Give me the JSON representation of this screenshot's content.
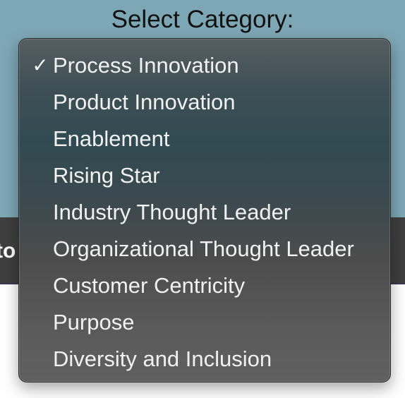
{
  "page": {
    "title": "Select Category:",
    "bar_text": "to"
  },
  "menu": {
    "selected_index": 0,
    "check_glyph": "✓",
    "items": [
      {
        "label": "Process Innovation",
        "selected": true
      },
      {
        "label": "Product Innovation",
        "selected": false
      },
      {
        "label": "Enablement",
        "selected": false
      },
      {
        "label": "Rising Star",
        "selected": false
      },
      {
        "label": "Industry Thought Leader",
        "selected": false
      },
      {
        "label": "Organizational Thought Leader",
        "selected": false
      },
      {
        "label": "Customer Centricity",
        "selected": false
      },
      {
        "label": "Purpose",
        "selected": false
      },
      {
        "label": "Diversity and Inclusion",
        "selected": false
      }
    ]
  },
  "colors": {
    "header_background": "#7ea7b5",
    "bar_background": "#3f3f3f",
    "menu_text": "#f1f1f1"
  }
}
